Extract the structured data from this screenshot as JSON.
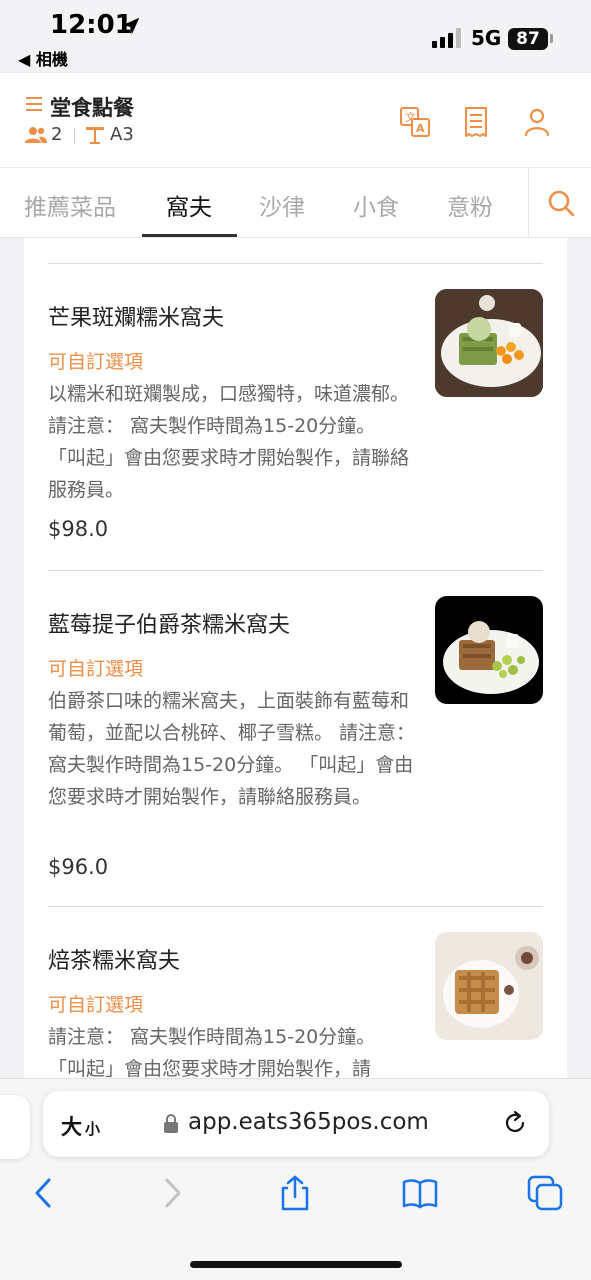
{
  "status": {
    "time": "12:01",
    "back_app": "◀ 相機",
    "network": "5G",
    "battery": "87"
  },
  "header": {
    "title": "堂食點餐",
    "guests": "2",
    "table": "A3"
  },
  "tabs": [
    {
      "label": "推薦菜品"
    },
    {
      "label": "窩夫"
    },
    {
      "label": "沙律"
    },
    {
      "label": "小食"
    },
    {
      "label": "意粉"
    }
  ],
  "items": [
    {
      "name": "芒果斑斕糯米窩夫",
      "option": "可自訂選項",
      "desc": "以糯米和斑斕製成，口感獨特，味道濃郁。　請注意： 窩夫製作時間為15-20分鐘。 「叫起」會由您要求時才開始製作，請聯絡服務員。",
      "price": "$98.0"
    },
    {
      "name": "藍莓提子伯爵茶糯米窩夫",
      "option": "可自訂選項",
      "desc": "伯爵茶口味的糯米窩夫，上面裝飾有藍莓和葡萄，並配以合桃碎、椰子雪糕。 請注意： 窩夫製作時間為15-20分鐘。 「叫起」會由您要求時才開始製作，請聯絡服務員。",
      "price": "$96.0"
    },
    {
      "name": "焙茶糯米窩夫",
      "option": "可自訂選項",
      "desc": "請注意： 窩夫製作時間為15-20分鐘。 「叫起」會由您要求時才開始製作，請"
    }
  ],
  "browser": {
    "text_size_big": "大",
    "text_size_small": "小",
    "url": "app.eats365pos.com"
  },
  "colors": {
    "accent": "#ef8f47",
    "ios_blue": "#1a73e8"
  }
}
